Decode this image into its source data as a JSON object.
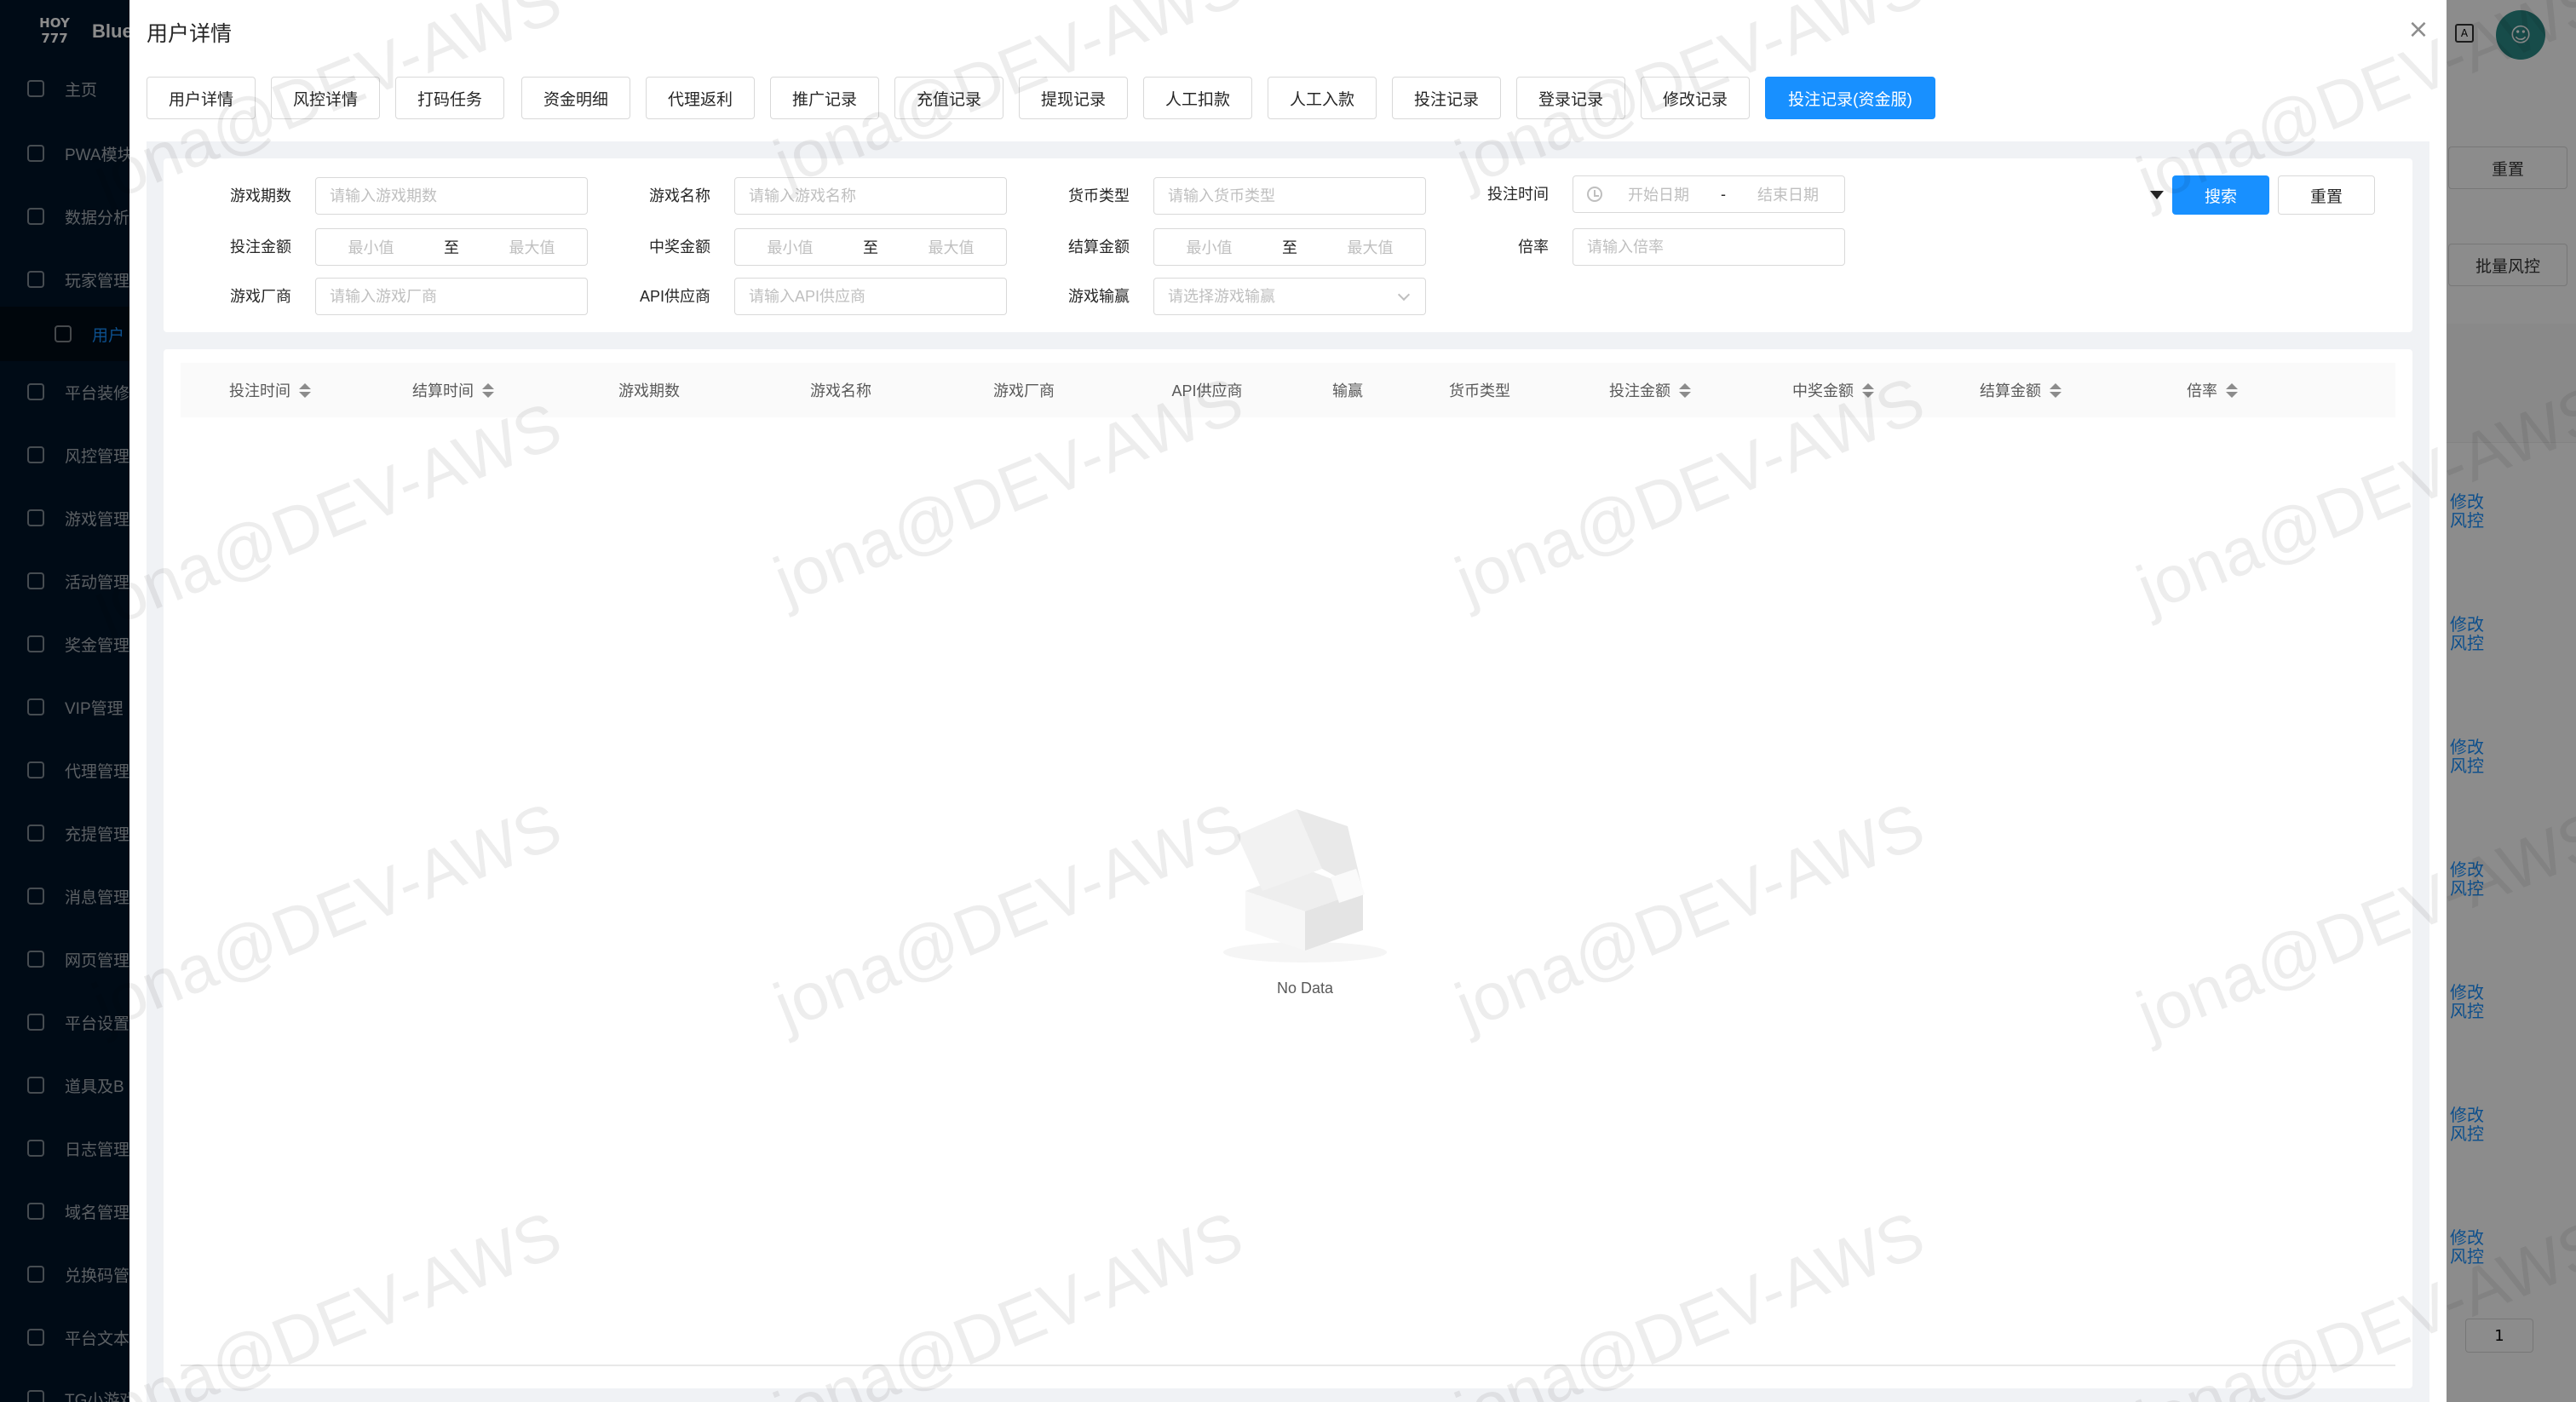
{
  "background": {
    "logo_text": "HOY 777",
    "brand": "Blue",
    "sidebar": [
      {
        "label": "主页"
      },
      {
        "label": "PWA模块"
      },
      {
        "label": "数据分析"
      },
      {
        "label": "玩家管理"
      },
      {
        "label": "用户"
      },
      {
        "label": "平台装修"
      },
      {
        "label": "风控管理"
      },
      {
        "label": "游戏管理"
      },
      {
        "label": "活动管理"
      },
      {
        "label": "奖金管理"
      },
      {
        "label": "VIP管理"
      },
      {
        "label": "代理管理"
      },
      {
        "label": "充提管理"
      },
      {
        "label": "消息管理"
      },
      {
        "label": "网页管理"
      },
      {
        "label": "平台设置"
      },
      {
        "label": "道具及B"
      },
      {
        "label": "日志管理"
      },
      {
        "label": "域名管理"
      },
      {
        "label": "兑换码管"
      },
      {
        "label": "平台文本"
      },
      {
        "label": "TG小游戏"
      }
    ],
    "right_buttons": {
      "reset": "重置",
      "batch_risk": "批量风控"
    },
    "row_link": "修改风控",
    "page_number": "1"
  },
  "modal": {
    "title": "用户详情",
    "close_icon": "×",
    "tabs": [
      {
        "label": "用户详情"
      },
      {
        "label": "风控详情"
      },
      {
        "label": "打码任务"
      },
      {
        "label": "资金明细"
      },
      {
        "label": "代理返利"
      },
      {
        "label": "推广记录"
      },
      {
        "label": "充值记录"
      },
      {
        "label": "提现记录"
      },
      {
        "label": "人工扣款"
      },
      {
        "label": "人工入款"
      },
      {
        "label": "投注记录"
      },
      {
        "label": "登录记录"
      },
      {
        "label": "修改记录"
      },
      {
        "label": "投注记录(资金服)"
      }
    ],
    "active_tab": "投注记录(资金服)"
  },
  "filters": {
    "game_period": {
      "label": "游戏期数",
      "placeholder": "请输入游戏期数"
    },
    "game_name": {
      "label": "游戏名称",
      "placeholder": "请输入游戏名称"
    },
    "currency": {
      "label": "货币类型",
      "placeholder": "请输入货币类型"
    },
    "bet_time": {
      "label": "投注时间",
      "start": "开始日期",
      "sep": "-",
      "end": "结束日期"
    },
    "bet_amount": {
      "label": "投注金额",
      "min": "最小值",
      "sep": "至",
      "max": "最大值"
    },
    "win_amount": {
      "label": "中奖金额",
      "min": "最小值",
      "sep": "至",
      "max": "最大值"
    },
    "settle_amount": {
      "label": "结算金额",
      "min": "最小值",
      "sep": "至",
      "max": "最大值"
    },
    "multiplier": {
      "label": "倍率",
      "placeholder": "请输入倍率"
    },
    "vendor": {
      "label": "游戏厂商",
      "placeholder": "请输入游戏厂商"
    },
    "api_provider": {
      "label": "API供应商",
      "placeholder": "请输入API供应商"
    },
    "win_lose": {
      "label": "游戏输赢",
      "placeholder": "请选择游戏输赢"
    },
    "search_button": "搜索",
    "reset_button": "重置"
  },
  "table": {
    "columns": [
      {
        "label": "投注时间",
        "sortable": true
      },
      {
        "label": "结算时间",
        "sortable": true
      },
      {
        "label": "游戏期数",
        "sortable": false
      },
      {
        "label": "游戏名称",
        "sortable": false
      },
      {
        "label": "游戏厂商",
        "sortable": false
      },
      {
        "label": "API供应商",
        "sortable": false
      },
      {
        "label": "输赢",
        "sortable": false
      },
      {
        "label": "货币类型",
        "sortable": false
      },
      {
        "label": "投注金额",
        "sortable": true
      },
      {
        "label": "中奖金额",
        "sortable": true
      },
      {
        "label": "结算金额",
        "sortable": true
      },
      {
        "label": "倍率",
        "sortable": true
      }
    ],
    "rows": [],
    "empty_text": "No Data"
  },
  "watermark": "jona@DEV-AWS",
  "colors": {
    "primary": "#1890ff",
    "sidebar": "#001529",
    "avatar": "#2a8a87"
  }
}
